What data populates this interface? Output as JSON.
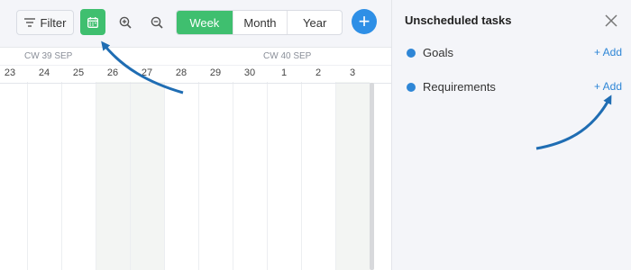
{
  "toolbar": {
    "filter_label": "Filter",
    "calendar_icon": "calendar-icon",
    "zoom_in_icon": "zoom-in-icon",
    "zoom_out_icon": "zoom-out-icon",
    "views": [
      "Week",
      "Month",
      "Year"
    ],
    "active_view": "Week",
    "add_label": "+"
  },
  "timeline": {
    "weeks": [
      "CW 39 SEP",
      "CW 40 SEP"
    ],
    "days": [
      "23",
      "24",
      "25",
      "26",
      "27",
      "28",
      "29",
      "30",
      "1",
      "2",
      "3"
    ]
  },
  "panel": {
    "title": "Unscheduled tasks",
    "items": [
      {
        "label": "Goals",
        "add": "+ Add"
      },
      {
        "label": "Requirements",
        "add": "+ Add"
      }
    ]
  },
  "colors": {
    "accent_green": "#3fbf6f",
    "accent_blue": "#2e8fe6",
    "dot_blue": "#2e86d6",
    "arrow_blue": "#1f6db3"
  }
}
